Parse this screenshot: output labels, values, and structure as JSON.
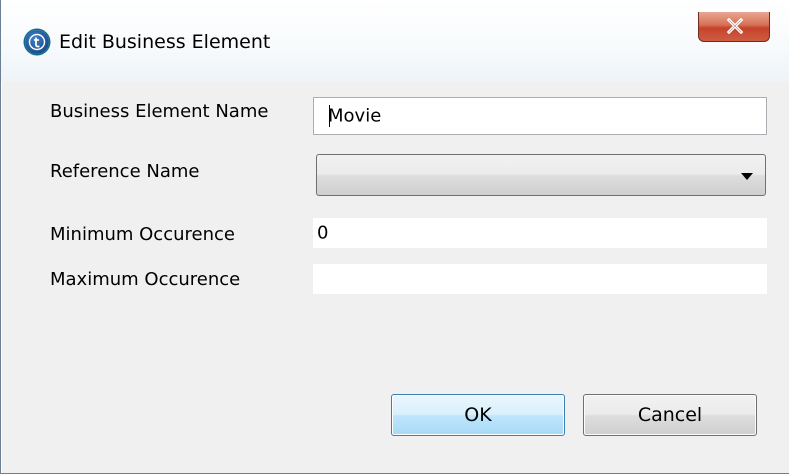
{
  "window": {
    "title": "Edit Business Element",
    "app_icon": "talend-icon",
    "close_icon": "close-icon"
  },
  "form": {
    "business_element_name": {
      "label": "Business Element Name",
      "value": "Movie"
    },
    "reference_name": {
      "label": "Reference Name",
      "value": ""
    },
    "minimum_occurence": {
      "label": "Minimum Occurence",
      "value": "0"
    },
    "maximum_occurence": {
      "label": "Maximum Occurence",
      "value": ""
    }
  },
  "buttons": {
    "ok_label": "OK",
    "cancel_label": "Cancel"
  },
  "colors": {
    "dialog_background": "#f0f0f0",
    "ok_button_border": "#3c7fb1",
    "close_button": "#c5432a"
  }
}
